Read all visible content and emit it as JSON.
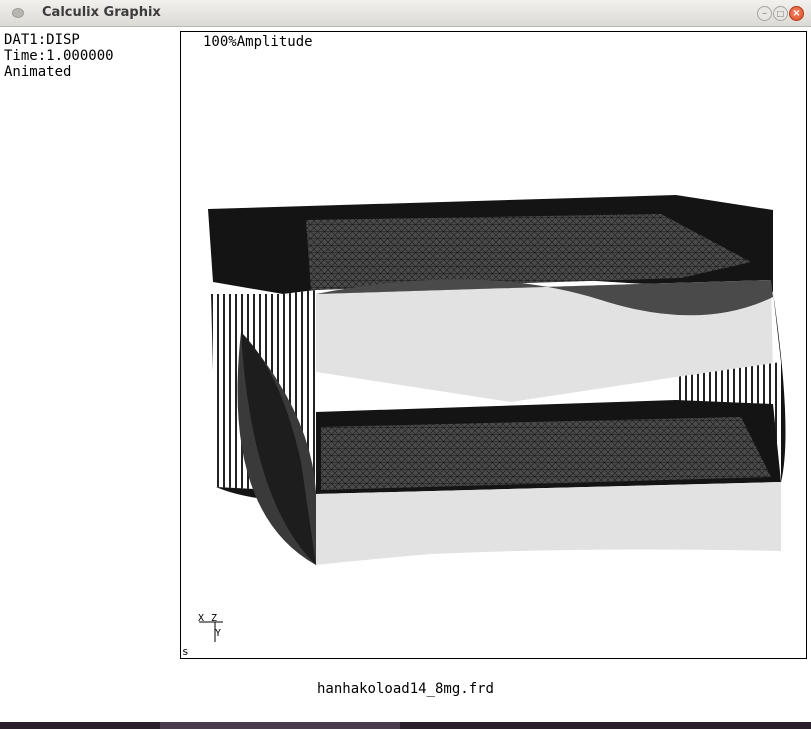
{
  "window": {
    "title": "Calculix Graphix",
    "controls": {
      "minimize": "–",
      "maximize": "□",
      "close": "×"
    }
  },
  "info": {
    "dataset": "DAT1:DISP",
    "time": "Time:1.000000",
    "mode": "Animated"
  },
  "viewport": {
    "amplitude": "100%Amplitude",
    "axes": {
      "x": "X",
      "z": "Z",
      "y": "Y"
    },
    "corner_mark": "s"
  },
  "footer": {
    "filename": "hanhakoload14_8mg.frd"
  },
  "colors": {
    "mesh_dark": "#141414",
    "mesh_mid": "#4a4a4a",
    "surface_light": "#e2e2e2",
    "close_button": "#e2562e"
  }
}
